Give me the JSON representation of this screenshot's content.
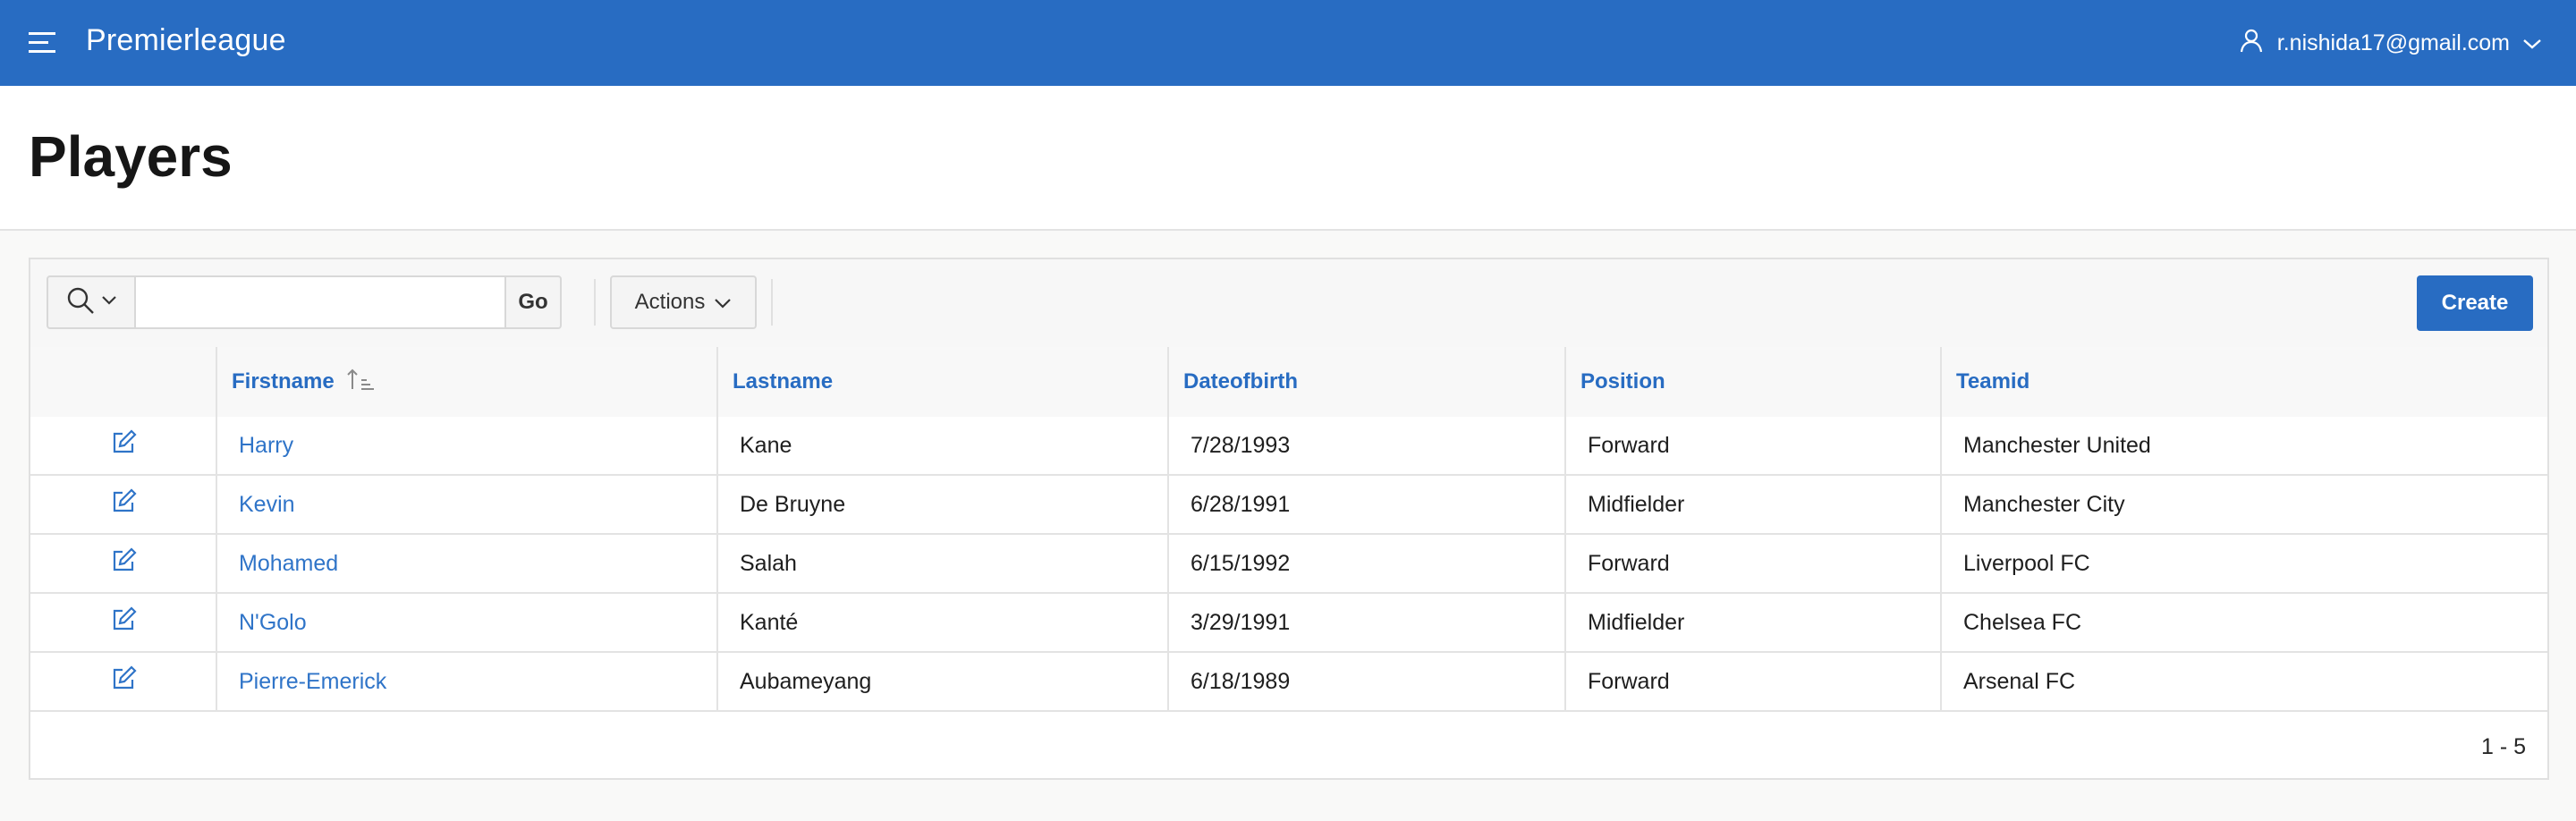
{
  "header": {
    "app_title": "Premierleague",
    "user_email": "r.nishida17@gmail.com",
    "menu_icon": "hamburger-menu-icon",
    "user_icon": "user-icon"
  },
  "page": {
    "title": "Players"
  },
  "toolbar": {
    "search_value": "",
    "go_label": "Go",
    "actions_label": "Actions",
    "create_label": "Create"
  },
  "table": {
    "columns": [
      "Firstname",
      "Lastname",
      "Dateofbirth",
      "Position",
      "Teamid"
    ],
    "sorted_column": "Firstname",
    "sort_direction": "ascending",
    "rows": [
      {
        "firstname": "Harry",
        "lastname": "Kane",
        "dob": "7/28/1993",
        "position": "Forward",
        "team": "Manchester United"
      },
      {
        "firstname": "Kevin",
        "lastname": "De Bruyne",
        "dob": "6/28/1991",
        "position": "Midfielder",
        "team": "Manchester City"
      },
      {
        "firstname": "Mohamed",
        "lastname": "Salah",
        "dob": "6/15/1992",
        "position": "Forward",
        "team": "Liverpool FC"
      },
      {
        "firstname": "N'Golo",
        "lastname": "Kanté",
        "dob": "3/29/1991",
        "position": "Midfielder",
        "team": "Chelsea FC"
      },
      {
        "firstname": "Pierre-Emerick",
        "lastname": "Aubameyang",
        "dob": "6/18/1989",
        "position": "Forward",
        "team": "Arsenal FC"
      }
    ]
  },
  "pagination": {
    "range": "1 - 5"
  },
  "colors": {
    "primary": "#286cc2",
    "link": "#2f74c8",
    "background": "#f9f9f8"
  }
}
